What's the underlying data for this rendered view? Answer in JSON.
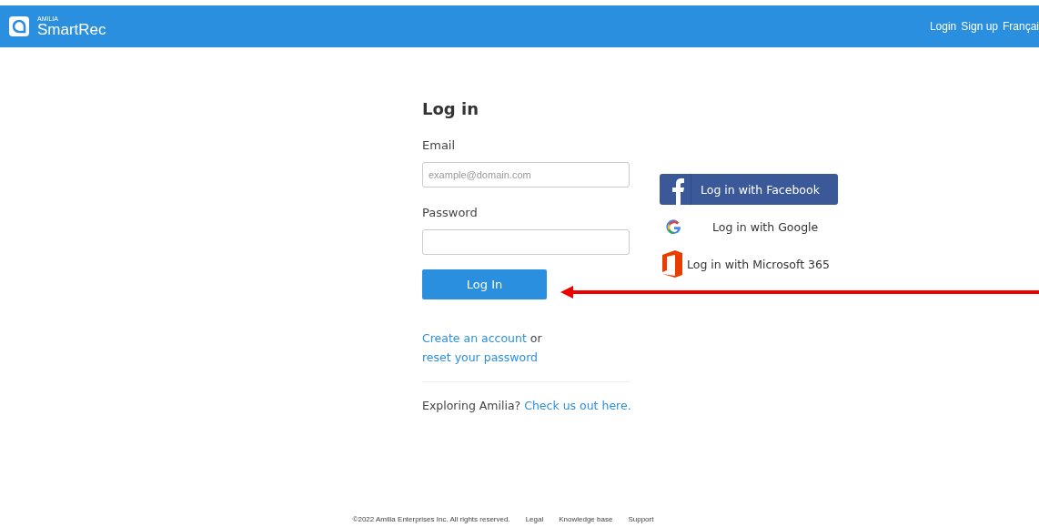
{
  "header": {
    "logo_small": "AMILIA",
    "logo_name": "SmartRec",
    "nav": [
      "Login",
      "Sign up",
      "Françai"
    ]
  },
  "form": {
    "title": "Log in",
    "fields": [
      {
        "label": "Email",
        "placeholder": "example@domain.com"
      },
      {
        "label": "Password"
      }
    ],
    "submit": "Log In",
    "links_sentence": [
      {
        "kind": "link",
        "text": "Create an account"
      },
      {
        "kind": "text",
        "text": " or "
      },
      {
        "kind": "link",
        "text": "reset your password"
      }
    ],
    "explore_sentence": [
      {
        "kind": "text",
        "text": "Exploring Amilia? "
      },
      {
        "kind": "link",
        "text": "Check us out here."
      }
    ]
  },
  "social": [
    {
      "kind": "facebook",
      "label": "Log in with Facebook"
    },
    {
      "kind": "google",
      "label": "Log in with Google"
    },
    {
      "kind": "microsoft",
      "label": "Log in with Microsoft 365"
    }
  ],
  "annotations": [
    {
      "kind": "arrow",
      "color": "#ee0000"
    }
  ],
  "footer": {
    "copyright": "©2022 Amilia Enterprises Inc. All rights reserved.",
    "links": [
      "Legal",
      "Knowledge base",
      "Support"
    ]
  }
}
